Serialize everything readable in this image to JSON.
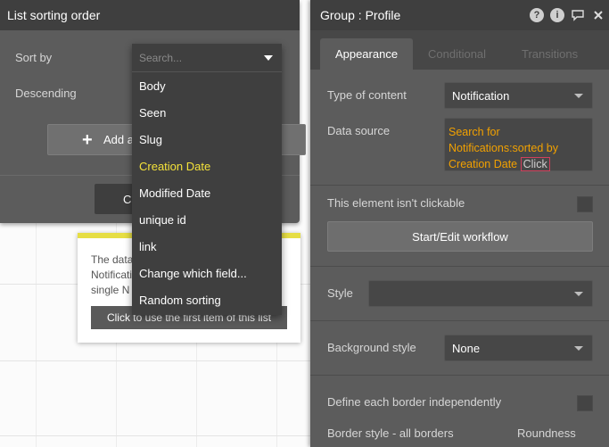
{
  "sort_panel": {
    "title": "List sorting order",
    "sort_by_label": "Sort by",
    "descending_label": "Descending",
    "add_button_label": "Add a",
    "close_button_label": "C"
  },
  "dropdown": {
    "search_placeholder": "Search...",
    "items": [
      {
        "label": "Body"
      },
      {
        "label": "Seen"
      },
      {
        "label": "Slug"
      },
      {
        "label": "Creation Date",
        "selected": true
      },
      {
        "label": "Modified Date"
      },
      {
        "label": "unique id"
      },
      {
        "label": "link"
      },
      {
        "label": "Change which field..."
      },
      {
        "label": "Random sorting"
      }
    ],
    "selected_color": "#f4e23a"
  },
  "tooltip": {
    "line1": "The data",
    "line2": "Notificati",
    "line3": "single N",
    "button_label": "Click to use the first item of this list"
  },
  "property_editor": {
    "title": "Group : Profile",
    "icons": [
      "help-icon",
      "info-icon",
      "comment-icon",
      "close-icon"
    ],
    "tabs": [
      {
        "label": "Appearance",
        "active": true
      },
      {
        "label": "Conditional"
      },
      {
        "label": "Transitions"
      }
    ],
    "type_of_content_label": "Type of content",
    "type_of_content_value": "Notification",
    "data_source_label": "Data source",
    "data_source_expr_1": "Search for",
    "data_source_expr_2": "Notifications:sorted by",
    "data_source_expr_3": "Creation Date",
    "data_source_click": "Click",
    "not_clickable_label": "This element isn't clickable",
    "workflow_button_label": "Start/Edit workflow",
    "style_label": "Style",
    "style_value": "",
    "background_style_label": "Background style",
    "background_style_value": "None",
    "border_independent_label": "Define each border independently",
    "border_style_label": "Border style - all borders",
    "roundness_label": "Roundness",
    "expression_color": "#f2a100"
  }
}
